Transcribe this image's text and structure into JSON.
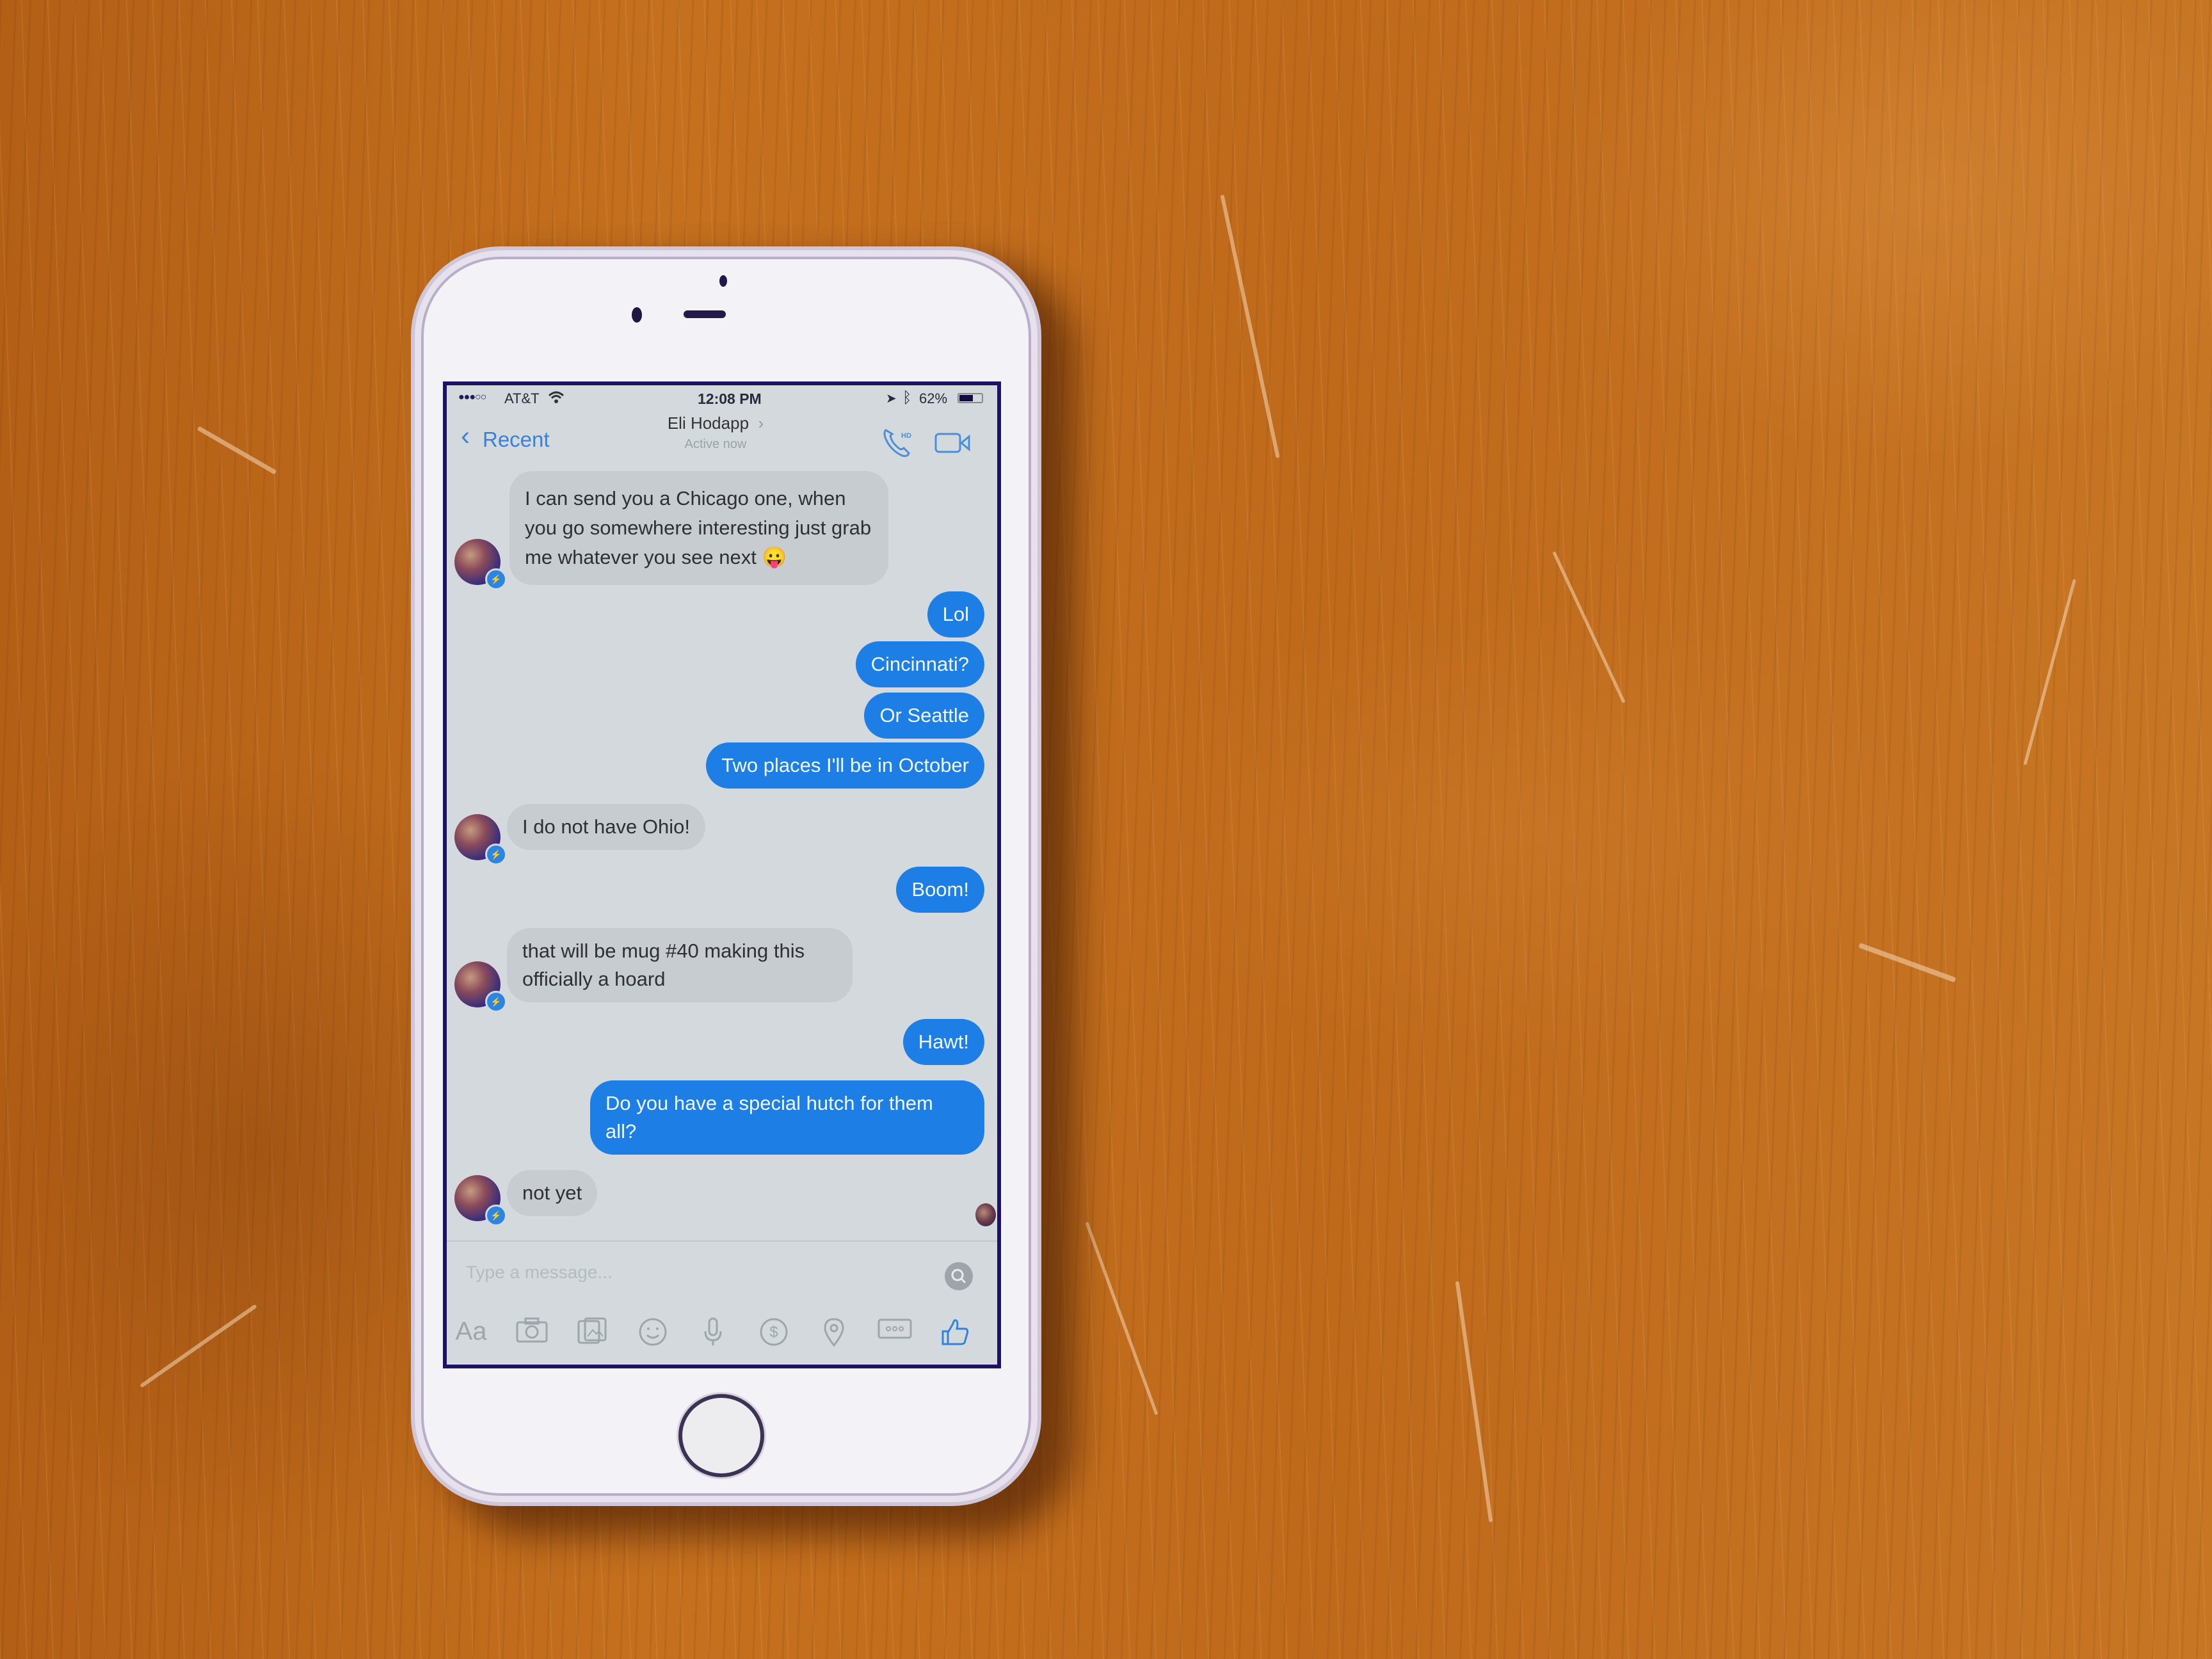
{
  "status_bar": {
    "signal_dots": "●●●○○",
    "carrier": "AT&T",
    "wifi_icon": "wifi-icon",
    "time": "12:08 PM",
    "location_icon": "location-arrow-icon",
    "bluetooth_icon": "bluetooth-icon",
    "battery_percent": "62%",
    "battery_level": 0.62
  },
  "nav": {
    "back_label": "Recent",
    "contact_name": "Eli Hodapp",
    "contact_chevron": "›",
    "presence": "Active now",
    "call_badge": "HD",
    "call_icon": "phone-hd-icon",
    "video_icon": "video-camera-icon"
  },
  "messages": [
    {
      "from": "them",
      "text": "I can send you a Chicago one, when you go somewhere interesting just grab me whatever you see next",
      "emoji": "😛"
    },
    {
      "from": "me",
      "text": "Lol"
    },
    {
      "from": "me",
      "text": "Cincinnati?"
    },
    {
      "from": "me",
      "text": "Or Seattle"
    },
    {
      "from": "me",
      "text": "Two places I'll be in October"
    },
    {
      "from": "them",
      "text": "I do not have Ohio!"
    },
    {
      "from": "me",
      "text": "Boom!"
    },
    {
      "from": "them",
      "text": "that will be mug #40 making this officially a hoard"
    },
    {
      "from": "me",
      "text": "Hawt!"
    },
    {
      "from": "me",
      "text": "Do you have a special hutch for them all?"
    },
    {
      "from": "them",
      "text": "not yet"
    }
  ],
  "composer": {
    "placeholder": "Type a message...",
    "toolbar": [
      {
        "icon": "text-format-icon",
        "label": "Aa"
      },
      {
        "icon": "camera-icon"
      },
      {
        "icon": "gallery-icon"
      },
      {
        "icon": "emoji-icon"
      },
      {
        "icon": "microphone-icon"
      },
      {
        "icon": "payment-icon",
        "label": "$"
      },
      {
        "icon": "location-pin-icon"
      },
      {
        "icon": "more-icon",
        "label": "ooo"
      },
      {
        "icon": "thumbs-up-icon"
      }
    ]
  },
  "colors": {
    "accent": "#1d7ee6",
    "incoming_bubble": "#c6ccd0",
    "screen_bg": "#d3d9dc",
    "wood": "#c06a1a"
  }
}
